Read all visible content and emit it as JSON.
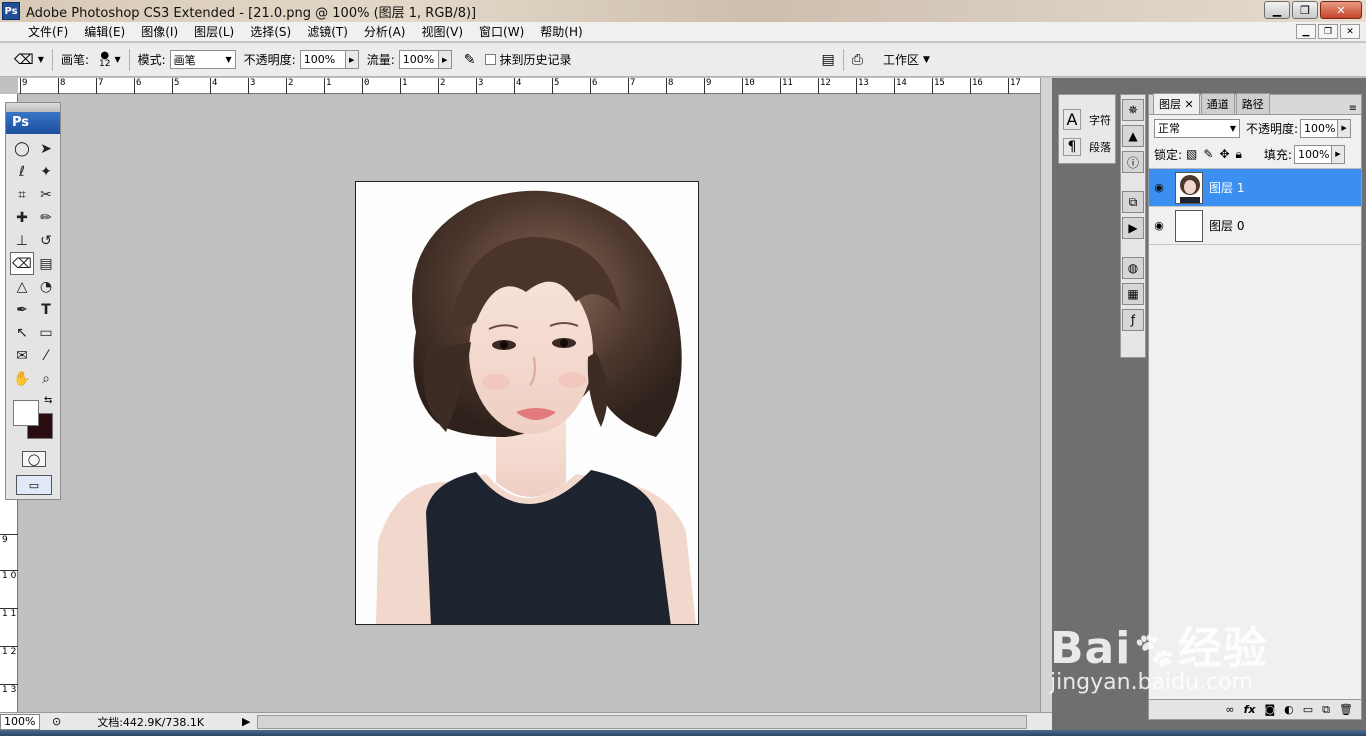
{
  "app": {
    "title": "Adobe Photoshop CS3 Extended - [21.0.png @ 100% (图层 1, RGB/8)]",
    "logo": "Ps"
  },
  "window_controls": [
    "minimize",
    "maximize",
    "close"
  ],
  "menu": [
    "文件(F)",
    "编辑(E)",
    "图像(I)",
    "图层(L)",
    "选择(S)",
    "滤镜(T)",
    "分析(A)",
    "视图(V)",
    "窗口(W)",
    "帮助(H)"
  ],
  "options": {
    "brush_label": "画笔:",
    "brush_size": "12",
    "mode_label": "模式:",
    "mode_value": "画笔",
    "opacity_label": "不透明度:",
    "opacity_value": "100%",
    "flow_label": "流量:",
    "flow_value": "100%",
    "erase_history_label": "抹到历史记录",
    "workspace_label": "工作区"
  },
  "ruler": {
    "top_ticks": [
      "9",
      "8",
      "7",
      "6",
      "5",
      "4",
      "3",
      "2",
      "1",
      "0",
      "1",
      "2",
      "3",
      "4",
      "5",
      "6",
      "7",
      "8",
      "9",
      "10",
      "11",
      "12",
      "13",
      "14",
      "15",
      "16",
      "17"
    ],
    "left_ticks": [
      "9",
      "1 0",
      "1 1",
      "1 2",
      "1 3"
    ]
  },
  "status": {
    "zoom": "100%",
    "doc_info": "文档:442.9K/738.1K"
  },
  "char_panel": {
    "char_label": "字符",
    "para_label": "段落"
  },
  "layers_panel": {
    "tabs": [
      "图层",
      "通道",
      "路径"
    ],
    "blend_mode": "正常",
    "opacity_label": "不透明度:",
    "opacity_value": "100%",
    "lock_label": "锁定:",
    "fill_label": "填充:",
    "fill_value": "100%",
    "layers": [
      {
        "name": "图层 1",
        "selected": true
      },
      {
        "name": "图层 0",
        "selected": false
      }
    ],
    "bottom_icons": [
      "link-icon",
      "fx-icon",
      "mask-icon",
      "adjustment-icon",
      "group-icon",
      "new-layer-icon",
      "trash-icon"
    ]
  },
  "watermark": {
    "brand": "Bai",
    "brand2": "经验",
    "url": "jingyan.baidu.com"
  },
  "colors": {
    "foreground": "#ffffff",
    "background": "#2a0d10",
    "selection": "#3a8ff0"
  }
}
